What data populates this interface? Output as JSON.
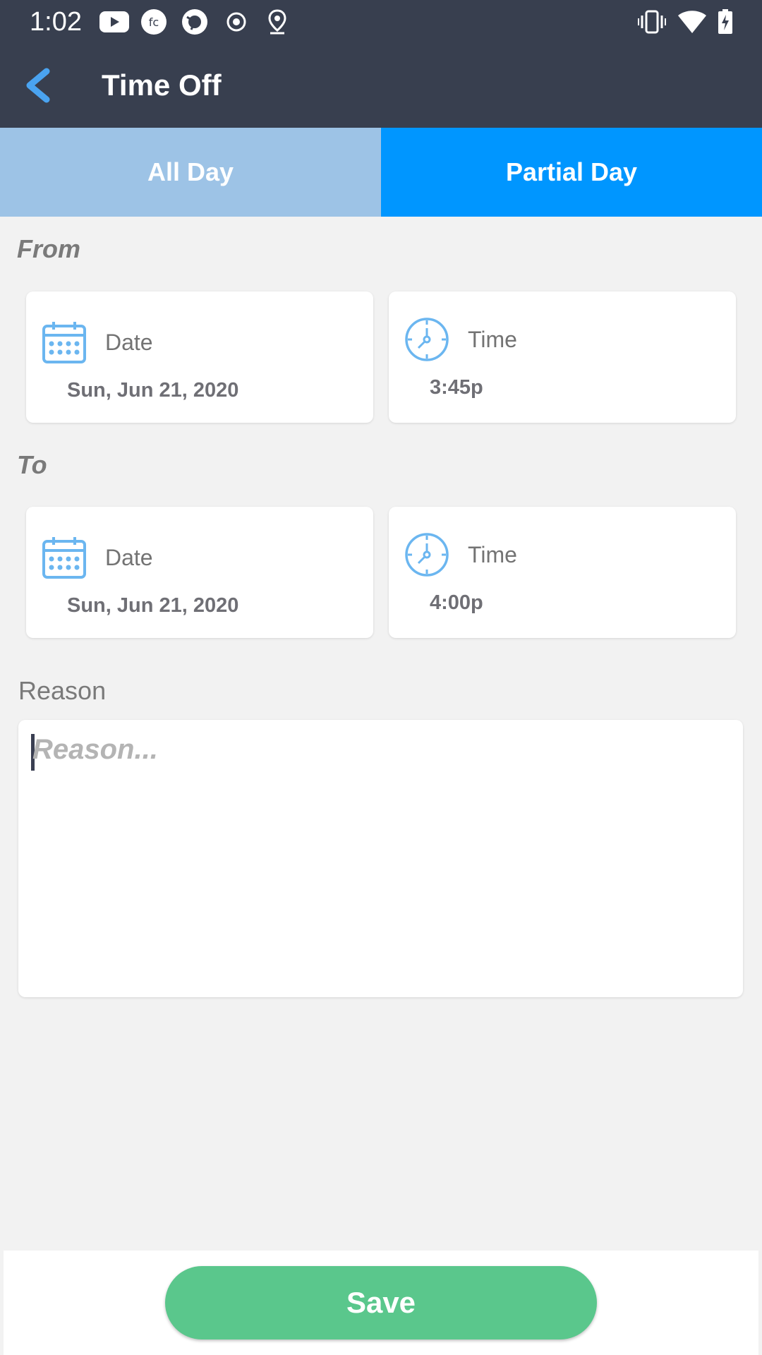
{
  "status_bar": {
    "time": "1:02",
    "left_icons": [
      "youtube-icon",
      "fc-app-icon",
      "camera-app-icon",
      "record-icon",
      "location-icon"
    ],
    "right_icons": [
      "vibrate-icon",
      "wifi-icon",
      "battery-charging-icon"
    ]
  },
  "header": {
    "title": "Time Off",
    "back_icon": "chevron-left-icon"
  },
  "tabs": [
    {
      "label": "All Day",
      "selected": false
    },
    {
      "label": "Partial Day",
      "selected": true
    }
  ],
  "from": {
    "label": "From",
    "date": {
      "label": "Date",
      "value": "Sun, Jun 21, 2020"
    },
    "time": {
      "label": "Time",
      "value": "3:45p"
    }
  },
  "to": {
    "label": "To",
    "date": {
      "label": "Date",
      "value": "Sun, Jun 21, 2020"
    },
    "time": {
      "label": "Time",
      "value": "4:00p"
    }
  },
  "reason": {
    "label": "Reason",
    "placeholder": "Reason...",
    "value": ""
  },
  "save_label": "Save",
  "colors": {
    "header_bg": "#383f4f",
    "tab_active": "#0096ff",
    "tab_inactive": "#9dc3e6",
    "icon_blue": "#6bb6f0",
    "save_green": "#5ac78c",
    "back_arrow": "#4aa3f0"
  }
}
